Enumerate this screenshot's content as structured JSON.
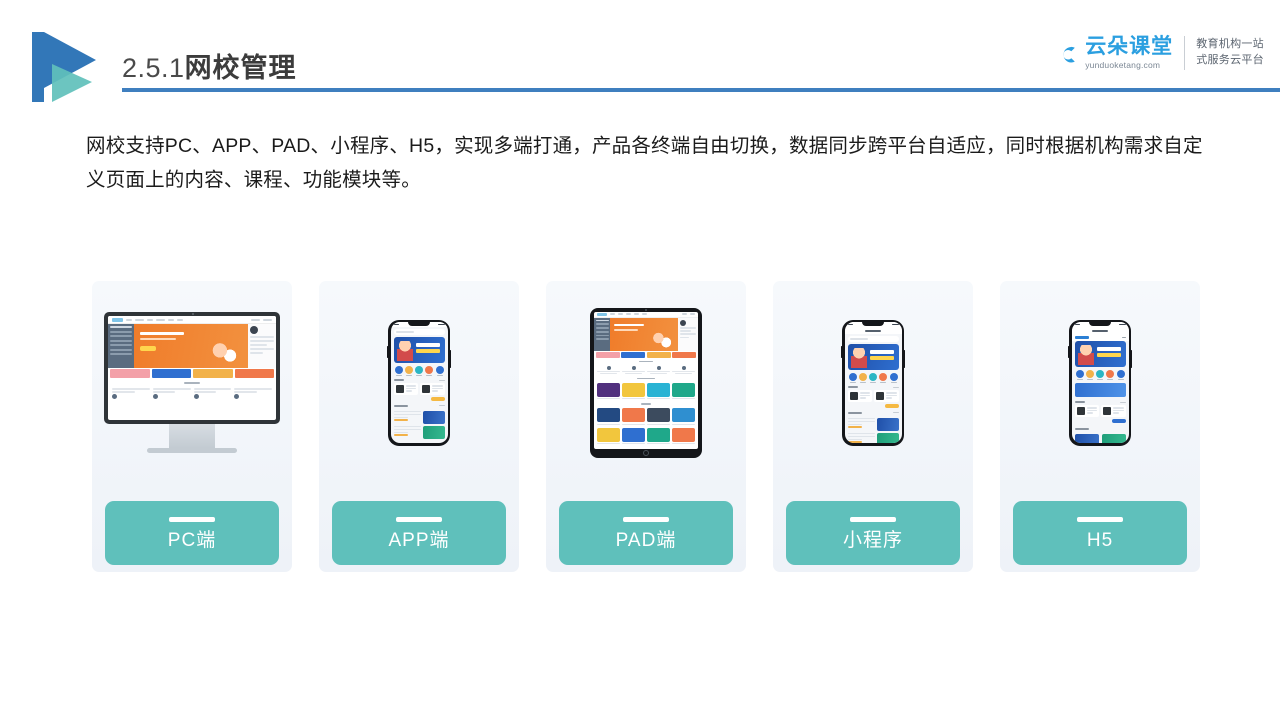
{
  "header": {
    "title_number": "2.5.1",
    "title_text": "网校管理",
    "rule_color": "#3f7fbf",
    "logo_icon": "play-triangle-logo"
  },
  "brand": {
    "name_cn": "云朵课堂",
    "url": "yunduoketang.com",
    "tagline_line1": "教育机构一站",
    "tagline_line2": "式服务云平台",
    "cloud_icon": "cloud-icon",
    "accent_color": "#2b9fe0"
  },
  "body": {
    "paragraph": "网校支持PC、APP、PAD、小程序、H5，实现多端打通，产品各终端自由切换，数据同步跨平台自适应，同时根据机构需求自定义页面上的内容、课程、功能模块等。"
  },
  "cards": [
    {
      "label": "PC端",
      "device": "desktop-monitor",
      "device_icon": "desktop-monitor-icon"
    },
    {
      "label": "APP端",
      "device": "smartphone",
      "device_icon": "smartphone-icon"
    },
    {
      "label": "PAD端",
      "device": "tablet",
      "device_icon": "tablet-icon"
    },
    {
      "label": "小程序",
      "device": "smartphone",
      "device_icon": "smartphone-icon"
    },
    {
      "label": "H5",
      "device": "smartphone",
      "device_icon": "smartphone-icon"
    }
  ],
  "theme": {
    "label_color": "#5fc0bb",
    "card_bg_top": "#f6f9fc",
    "card_bg_bottom": "#eef2f8",
    "logo_blue": "#3277b8",
    "logo_teal": "#5fc0bb"
  }
}
